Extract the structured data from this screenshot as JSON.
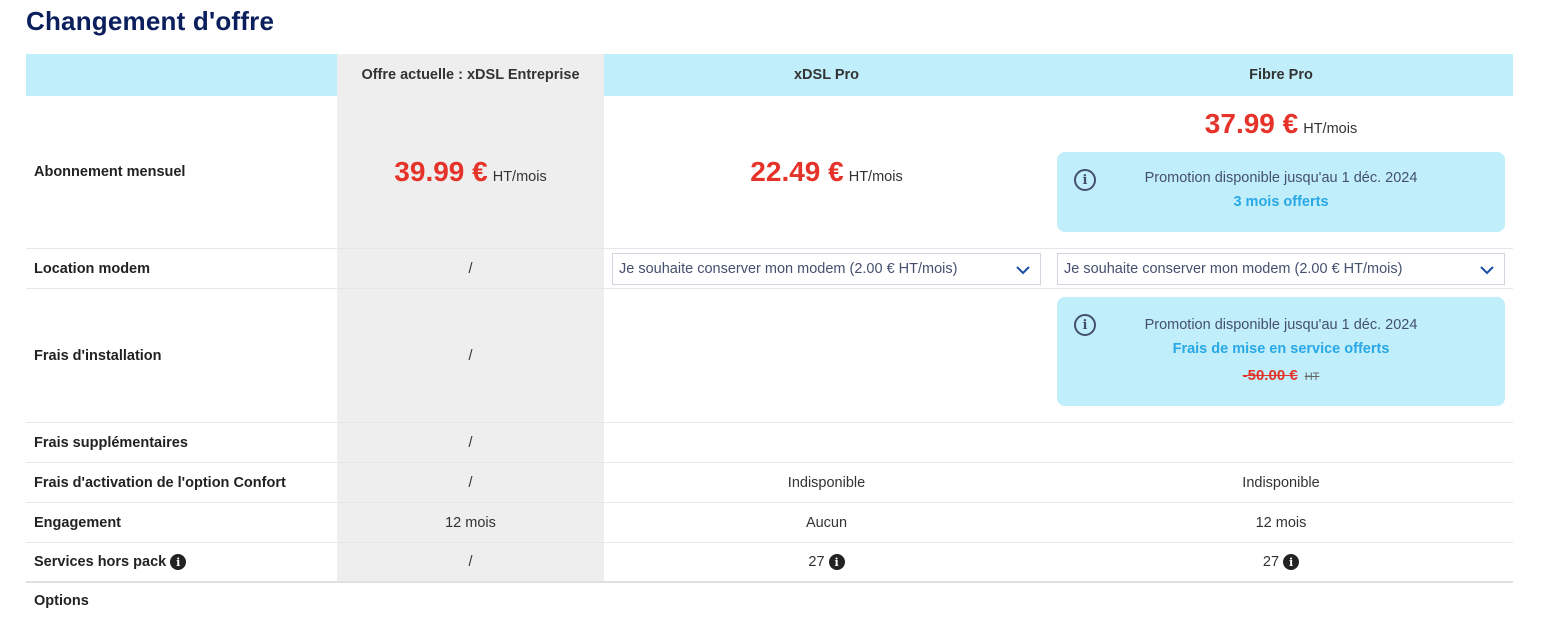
{
  "page": {
    "title": "Changement d'offre"
  },
  "columns": {
    "current": "Offre actuelle : xDSL Entreprise",
    "xdsl_pro": "xDSL Pro",
    "fibre_pro": "Fibre Pro"
  },
  "rows": {
    "subscription": {
      "label": "Abonnement mensuel",
      "current": {
        "amount": "39.99 €",
        "unit": "HT/mois"
      },
      "xdsl_pro": {
        "amount": "22.49 €",
        "unit": "HT/mois"
      },
      "fibre_pro": {
        "amount": "37.99 €",
        "unit": "HT/mois",
        "promo_text": "Promotion disponible jusqu'au 1 déc. 2024",
        "promo_highlight": "3 mois offerts"
      }
    },
    "modem": {
      "label": "Location modem",
      "current": "/",
      "xdsl_pro_select": "Je souhaite conserver mon modem (2.00 € HT/mois)",
      "fibre_pro_select": "Je souhaite conserver mon modem (2.00 € HT/mois)"
    },
    "installation": {
      "label": "Frais d'installation",
      "current": "/",
      "fibre_pro": {
        "promo_text": "Promotion disponible jusqu'au 1 déc. 2024",
        "promo_highlight": "Frais de mise en service offerts",
        "old_amount": "-50.00 €",
        "old_unit": "HT"
      }
    },
    "extra_fees": {
      "label": "Frais supplémentaires",
      "current": "/"
    },
    "confort": {
      "label": "Frais d'activation de l'option Confort",
      "current": "/",
      "xdsl_pro": "Indisponible",
      "fibre_pro": "Indisponible"
    },
    "engagement": {
      "label": "Engagement",
      "current": "12 mois",
      "xdsl_pro": "Aucun",
      "fibre_pro": "12 mois"
    },
    "services": {
      "label": "Services hors pack",
      "current": "/",
      "xdsl_pro": "27",
      "fibre_pro": "27"
    }
  },
  "options": {
    "label": "Options"
  },
  "icons": {
    "info": "i"
  },
  "colors": {
    "accent_bg": "#c1eefb",
    "price_red": "#e5332a",
    "highlight_blue": "#29a8e6",
    "title_navy": "#0b1f5c"
  }
}
